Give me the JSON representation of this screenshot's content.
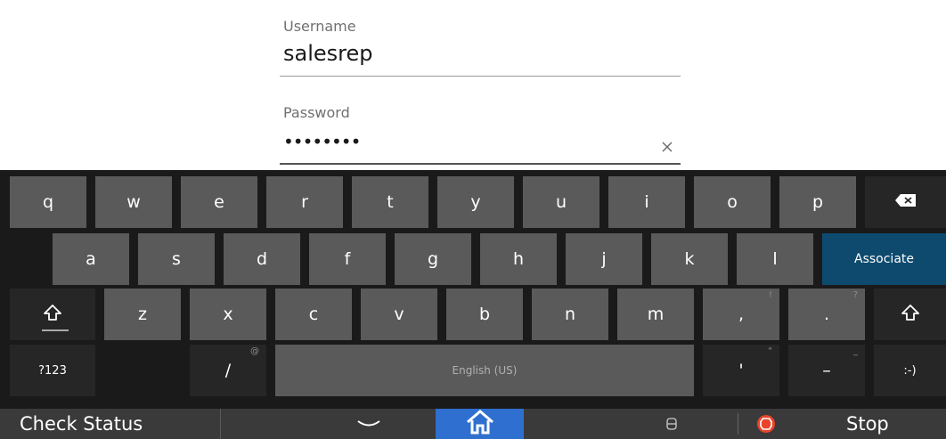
{
  "form": {
    "username": {
      "label": "Username",
      "value": "salesrep"
    },
    "password": {
      "label": "Password",
      "value": "••••••••",
      "clear_icon": "clear-icon"
    }
  },
  "keyboard": {
    "row1": [
      "q",
      "w",
      "e",
      "r",
      "t",
      "y",
      "u",
      "i",
      "o",
      "p"
    ],
    "row2": [
      "a",
      "s",
      "d",
      "f",
      "g",
      "h",
      "j",
      "k",
      "l"
    ],
    "row3": [
      "z",
      "x",
      "c",
      "v",
      "b",
      "n",
      "m"
    ],
    "backspace_icon": "backspace-icon",
    "associate": "Associate",
    "shift_icon": "shift-icon",
    "comma": ",",
    "comma_hint": "!",
    "period": ".",
    "period_hint": "?",
    "numbers": "?123",
    "slash": "/",
    "slash_hint": "@",
    "space": "English (US)",
    "apostrophe": "'",
    "apostrophe_hint": "\"",
    "dash": "–",
    "dash_hint": "_",
    "smiley": ":-)"
  },
  "bottom_bar": {
    "check_status": "Check Status",
    "chevron_icon": "chevron-down-icon",
    "home_icon": "home-icon",
    "memory_icon": "memory-icon",
    "stop_icon": "stop-icon",
    "stop": "Stop",
    "home_color": "#2f6fcf",
    "stop_color": "#e8452a"
  },
  "colors": {
    "key": "#5a5a5a",
    "key_dark": "#262626",
    "associate": "#0e4a6e"
  }
}
